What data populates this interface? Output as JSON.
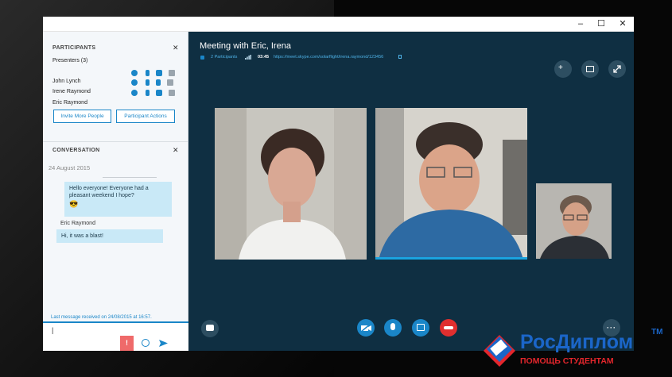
{
  "window": {
    "controls": {
      "minimize": "–",
      "maximize": "☐",
      "close": "✕"
    }
  },
  "participants": {
    "header": "PARTICIPANTS",
    "close": "✕",
    "presenters_label": "Presenters (3)",
    "people": [
      "John Lynch",
      "Irene Raymond",
      "Eric Raymond"
    ],
    "invite_button": "Invite More People",
    "actions_button": "Participant Actions"
  },
  "conversation": {
    "header": "CONVERSATION",
    "close": "✕",
    "date": "24 August 2015",
    "messages": [
      {
        "text_line1": "Hello everyone! Everyone had a",
        "text_line2": "pleasant weekend I hope?",
        "emoji": "😎"
      },
      {
        "sender": "Eric Raymond",
        "text": "Hi, it was a blast!"
      }
    ],
    "last_message": "Last message received on 24/08/2015 at 16:57.",
    "input_value": "|"
  },
  "meeting": {
    "title": "Meeting with Eric, Irena",
    "participants_link": "2 Participants",
    "time": "03:45",
    "url": "https://meet.skype.com/solarflight/irena.raymond/123456"
  },
  "watermark": {
    "brand": "РосДиплом",
    "tagline": "ПОМОЩЬ СТУДЕНТАМ",
    "tm": "TM"
  },
  "colors": {
    "accent": "#1a86c8",
    "meeting_bg": "#0f2f42",
    "hangup": "#e02f2f",
    "watermark_blue": "#1b66c9",
    "watermark_red": "#e3262c"
  }
}
